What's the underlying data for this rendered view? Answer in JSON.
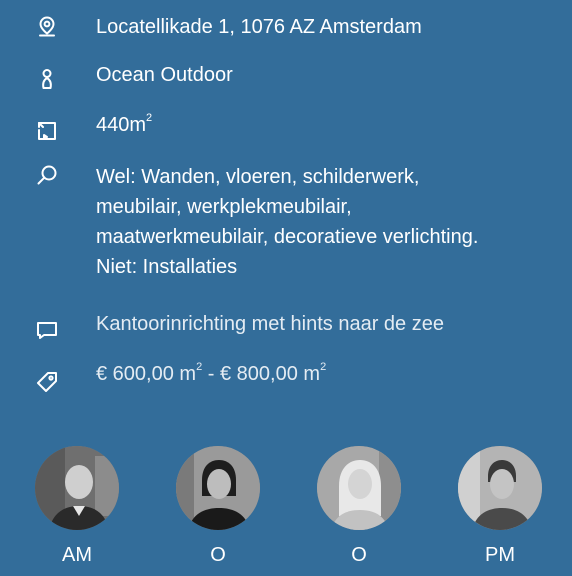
{
  "details": {
    "address": {
      "icon": "location-pin-icon",
      "text": "Locatellikade 1, 1076 AZ Amsterdam"
    },
    "client": {
      "icon": "person-icon",
      "text": "Ocean Outdoor"
    },
    "area": {
      "icon": "floor-area-icon",
      "value": "440m",
      "unit_sup": "2"
    },
    "scope": {
      "icon": "search-icon",
      "lines": [
        "Wel: Wanden, vloeren, schilderwerk,",
        "meubilair, werkplekmeubilair,",
        "maatwerkmeubilair, decoratieve verlichting.",
        "Niet: Installaties"
      ]
    },
    "concept": {
      "icon": "speech-bubble-icon",
      "text": "Kantoorinrichting met hints naar de zee"
    },
    "price": {
      "icon": "price-tag-icon",
      "from": "€ 600,00 m",
      "from_sup": "2",
      "separator": " - ",
      "to": "€ 800,00 m",
      "to_sup": "2"
    }
  },
  "team": [
    {
      "initials": "AM"
    },
    {
      "initials": "O"
    },
    {
      "initials": "O"
    },
    {
      "initials": "PM"
    }
  ],
  "colors": {
    "background": "#336d9a",
    "text": "#ffffff"
  }
}
